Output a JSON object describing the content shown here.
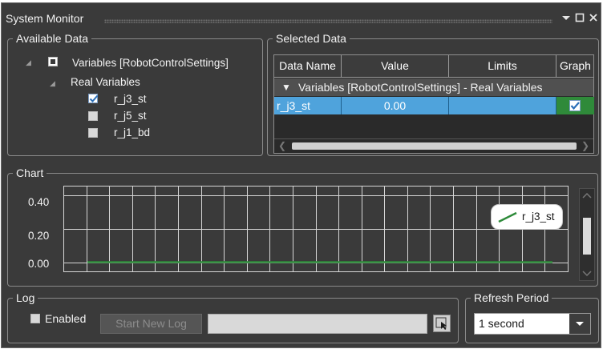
{
  "window": {
    "title": "System Monitor"
  },
  "available_data": {
    "legend": "Available Data",
    "root_label": "Variables [RobotControlSettings]",
    "group_label": "Real Variables",
    "variables": [
      {
        "name": "r_j3_st",
        "checked": true
      },
      {
        "name": "r_j5_st",
        "checked": false
      },
      {
        "name": "r_j1_bd",
        "checked": false
      }
    ]
  },
  "selected_data": {
    "legend": "Selected Data",
    "columns": [
      "Data Name",
      "Value",
      "Limits",
      "Graph"
    ],
    "group_row": "Variables [RobotControlSettings] - Real Variables",
    "rows": [
      {
        "name": "r_j3_st",
        "value": "0.00",
        "limits": "",
        "graph": true
      }
    ]
  },
  "chart": {
    "legend": "Chart",
    "legend_entry": "r_j3_st"
  },
  "chart_data": {
    "type": "line",
    "title": "",
    "xlabel": "",
    "ylabel": "",
    "ylim": [
      -0.06,
      0.46
    ],
    "yticks": [
      "0.40",
      "0.20",
      "0.00"
    ],
    "grid": true,
    "legend_position": "top-right",
    "series": [
      {
        "name": "r_j3_st",
        "color": "#2e8b3a",
        "values": [
          0.0,
          0.0
        ]
      }
    ]
  },
  "log": {
    "legend": "Log",
    "enabled_label": "Enabled",
    "enabled": false,
    "start_button": "Start New Log",
    "path_value": ""
  },
  "refresh": {
    "legend": "Refresh Period",
    "selected": "1 second"
  },
  "colors": {
    "accent_blue": "#4fa3dc",
    "series_green": "#2e8b3a",
    "graph_cell_green": "#2f8a3a"
  }
}
